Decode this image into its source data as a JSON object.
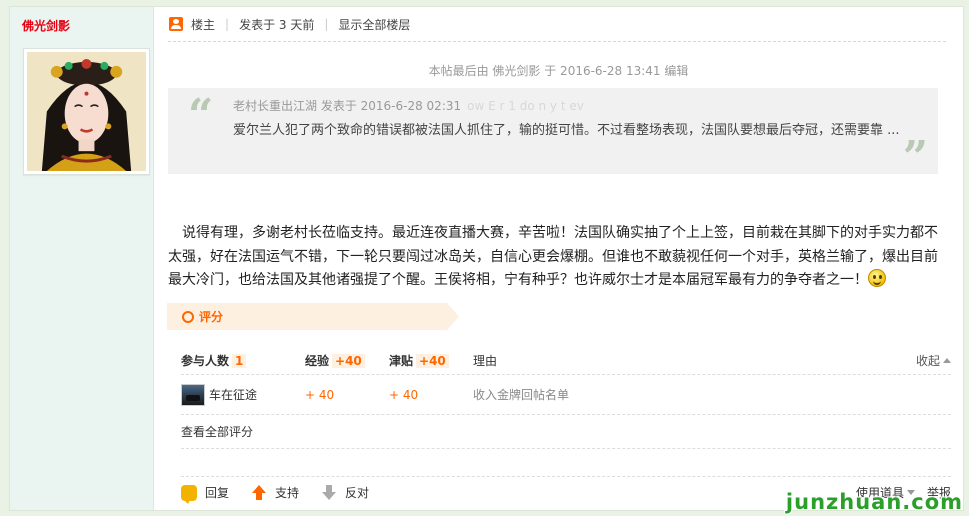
{
  "author": {
    "name": "佛光剑影"
  },
  "meta": {
    "floor_owner": "楼主",
    "posted": "发表于 3 天前",
    "show_all": "显示全部楼层"
  },
  "edit_note": "本帖最后由 佛光剑影 于 2016-6-28 13:41 编辑",
  "quote": {
    "header": "老村长重出江湖 发表于 2016-6-28 02:31",
    "ghost": "ow E r 1 do n y t ev",
    "body": "爱尔兰人犯了两个致命的错误都被法国人抓住了，输的挺可惜。不过看整场表现，法国队要想最后夺冠，还需要靠 ..."
  },
  "content": "说得有理，多谢老村长莅临支持。最近连夜直播大赛，辛苦啦！法国队确实抽了个上上签，目前栽在其脚下的对手实力都不太强，好在法国运气不错，下一轮只要闯过冰岛关，自信心更会爆棚。但谁也不敢藐视任何一个对手，英格兰输了，爆出目前最大冷门，也给法国及其他诸强提了个醒。王侯将相，宁有种乎？也许威尔士才是本届冠军最有力的争夺者之一！",
  "rating": {
    "tab_label": "评分",
    "headers": {
      "participants": "参与人数",
      "participants_count": "1",
      "exp": "经验",
      "exp_total": "+40",
      "tie": "津贴",
      "tie_total": "+40",
      "reason": "理由",
      "collapse": "收起"
    },
    "rows": [
      {
        "user": "车在征途",
        "exp": "+ 40",
        "tie": "+ 40",
        "reason": "收入金牌回帖名单"
      }
    ],
    "view_all": "查看全部评分"
  },
  "actions": {
    "reply": "回复",
    "support": "支持",
    "oppose": "反对",
    "tools": "使用道具",
    "report": "举报"
  },
  "watermark": "junzhuan.com"
}
